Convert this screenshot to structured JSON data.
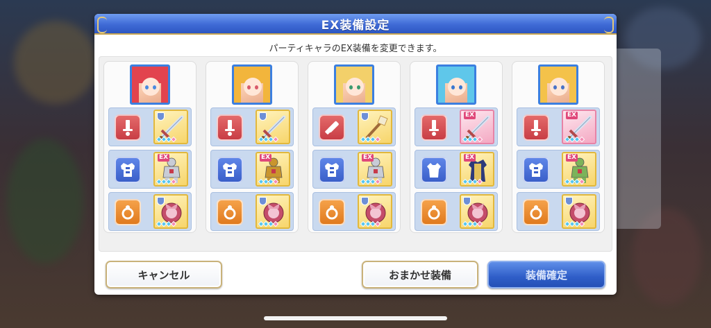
{
  "dialog": {
    "title": "EX装備設定",
    "subtitle": "パーティキャラのEX装備を変更できます。"
  },
  "buttons": {
    "cancel": "キャンセル",
    "auto": "おまかせ装備",
    "confirm": "装備確定"
  },
  "characters": [
    {
      "portrait_colors": {
        "hair": "#e2434e",
        "eye": "#4a8be0"
      },
      "slots": [
        {
          "type": "weapon",
          "ex_label": "",
          "item_bg": "gold",
          "item_icon": "sword-icon",
          "gems": 4
        },
        {
          "type": "armor",
          "ex_label": "EX",
          "item_bg": "gold",
          "item_icon": "armor-icon",
          "gems": 4
        },
        {
          "type": "accessory",
          "ex_label": "",
          "item_bg": "gold",
          "item_icon": "ribbon-accessory-icon",
          "gems": 4
        }
      ]
    },
    {
      "portrait_colors": {
        "hair": "#f2b53c",
        "eye": "#d85a6a"
      },
      "slots": [
        {
          "type": "weapon",
          "ex_label": "",
          "item_bg": "gold",
          "item_icon": "sword-icon",
          "gems": 4
        },
        {
          "type": "armor",
          "ex_label": "EX",
          "item_bg": "gold",
          "item_icon": "golden-armor-icon",
          "gems": 4
        },
        {
          "type": "accessory",
          "ex_label": "",
          "item_bg": "gold",
          "item_icon": "charm-accessory-icon",
          "gems": 4
        }
      ]
    },
    {
      "portrait_colors": {
        "hair": "#f3d06a",
        "eye": "#3a9a6e"
      },
      "slots": [
        {
          "type": "weapon-fist",
          "ex_label": "",
          "item_bg": "gold",
          "item_icon": "wand-icon",
          "gems": 4
        },
        {
          "type": "armor",
          "ex_label": "EX",
          "item_bg": "gold",
          "item_icon": "armor-icon",
          "gems": 4
        },
        {
          "type": "accessory",
          "ex_label": "",
          "item_bg": "gold",
          "item_icon": "ribbon-accessory-icon",
          "gems": 4
        }
      ]
    },
    {
      "portrait_colors": {
        "hair": "#5fc7ea",
        "eye": "#3a76d0"
      },
      "slots": [
        {
          "type": "weapon",
          "ex_label": "EX",
          "item_bg": "pink",
          "item_icon": "spear-icon",
          "gems": 4
        },
        {
          "type": "robe",
          "ex_label": "EX",
          "item_bg": "gold",
          "item_icon": "robe-icon",
          "gems": 4
        },
        {
          "type": "accessory",
          "ex_label": "",
          "item_bg": "gold",
          "item_icon": "ribbon-accessory-icon",
          "gems": 4
        }
      ]
    },
    {
      "portrait_colors": {
        "hair": "#f4c24a",
        "eye": "#4a72c8"
      },
      "slots": [
        {
          "type": "weapon",
          "ex_label": "EX",
          "item_bg": "pink",
          "item_icon": "sword-icon",
          "gems": 4
        },
        {
          "type": "armor",
          "ex_label": "EX",
          "item_bg": "gold",
          "item_icon": "green-armor-icon",
          "gems": 4
        },
        {
          "type": "accessory",
          "ex_label": "",
          "item_bg": "gold",
          "item_icon": "ribbon-accessory-icon",
          "gems": 4
        }
      ]
    }
  ]
}
